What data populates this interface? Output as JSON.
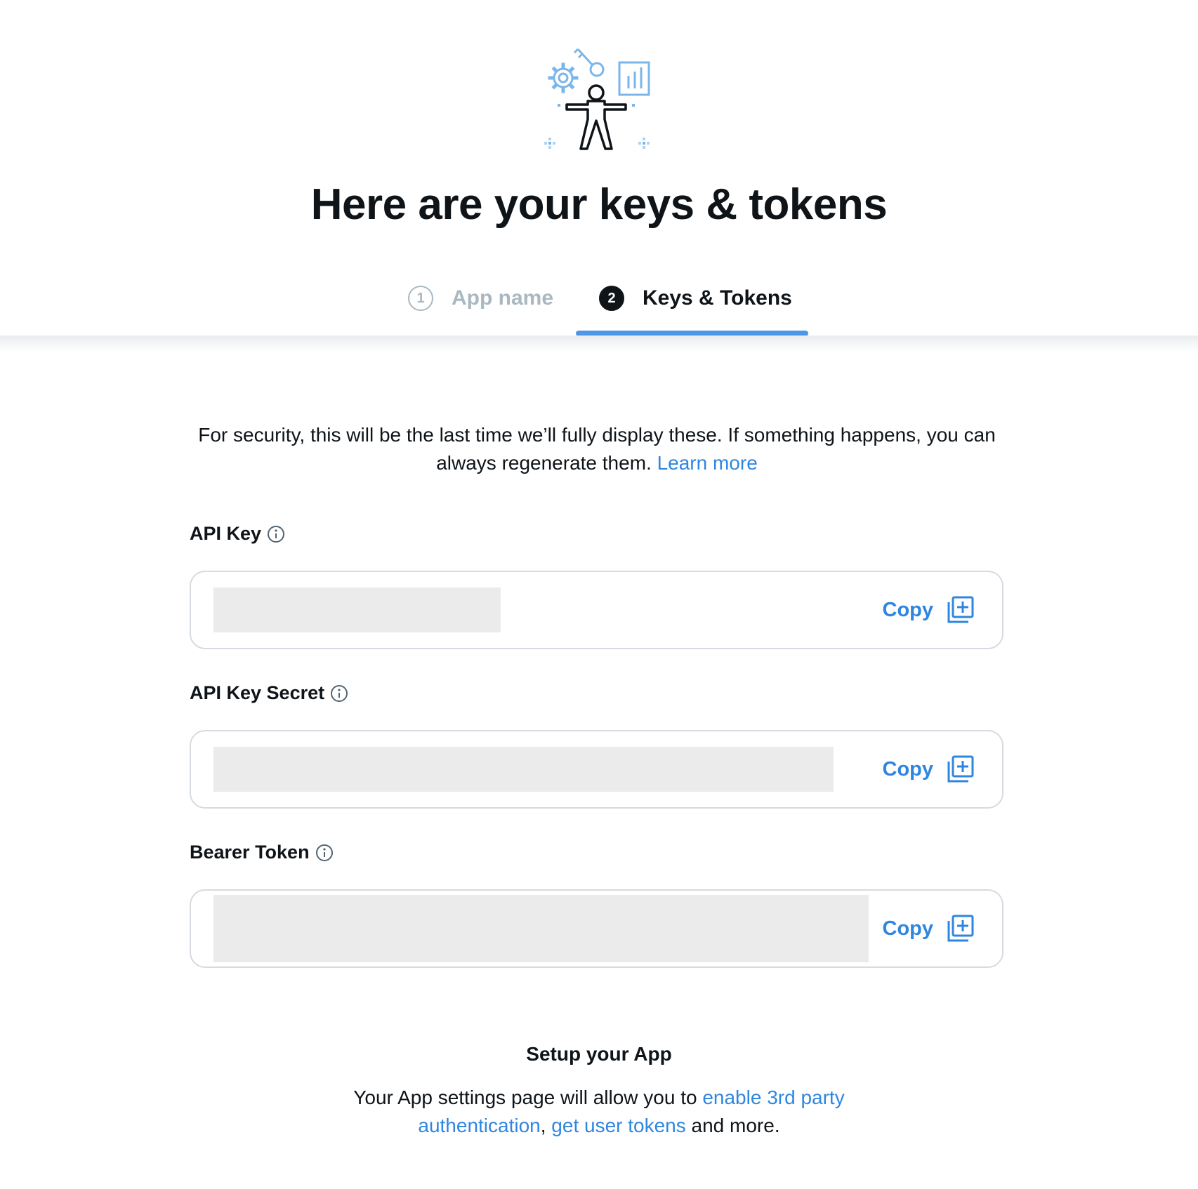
{
  "header": {
    "title": "Here are your keys & tokens",
    "illustration_icon": "developer-keys-illustration"
  },
  "stepper": {
    "steps": [
      {
        "number": "1",
        "label": "App name",
        "state": "completed"
      },
      {
        "number": "2",
        "label": "Keys & Tokens",
        "state": "active"
      }
    ]
  },
  "intro": {
    "text": "For security, this will be the last time we’ll fully display these. If something happens, you can always regenerate them. ",
    "link": "Learn more"
  },
  "fields": [
    {
      "label": "API Key",
      "copy_label": "Copy",
      "value_redacted": true
    },
    {
      "label": "API Key Secret",
      "copy_label": "Copy",
      "value_redacted": true
    },
    {
      "label": "Bearer Token",
      "copy_label": "Copy",
      "value_redacted": true
    }
  ],
  "setup": {
    "title": "Setup your App",
    "text_before": "Your App settings page will allow you to ",
    "link_1": "enable 3rd party authentication",
    "separator": ", ",
    "link_2": "get user tokens",
    "text_after": " and more."
  },
  "colors": {
    "accent": "#2f86e0",
    "active_bar": "#4c97e8",
    "text": "#0f1419",
    "muted": "#aab8c2",
    "illustration": "#7bb6ea"
  }
}
